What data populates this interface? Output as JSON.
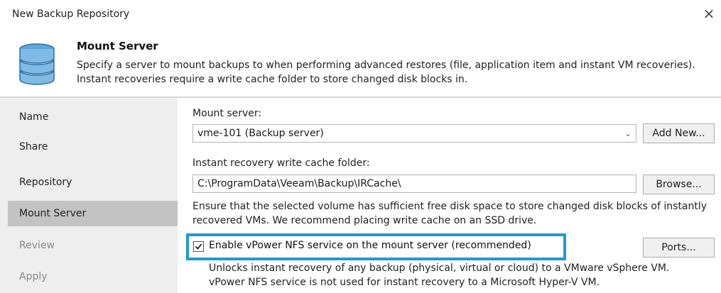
{
  "window": {
    "title": "New Backup Repository",
    "close_icon": "×"
  },
  "header": {
    "icon": "database-icon",
    "title": "Mount Server",
    "description_line1": "Specify a server to mount backups to when performing advanced restores (file, application item and instant VM recoveries).",
    "description_line2": "Instant recoveries require a write cache folder to store changed disk blocks in."
  },
  "sidebar": {
    "items": [
      {
        "label": "Name",
        "state": "normal"
      },
      {
        "label": "Share",
        "state": "normal"
      },
      {
        "label": "Repository",
        "state": "normal"
      },
      {
        "label": "Mount Server",
        "state": "active"
      },
      {
        "label": "Review",
        "state": "disabled"
      },
      {
        "label": "Apply",
        "state": "disabled"
      }
    ]
  },
  "mount_server": {
    "label": "Mount server:",
    "selected": "vme-101 (Backup server)",
    "add_new_label": "Add New..."
  },
  "cache_folder": {
    "label": "Instant recovery write cache folder:",
    "value": "C:\\ProgramData\\Veeam\\Backup\\IRCache\\",
    "browse_label": "Browse...",
    "note_line1": "Ensure that the selected volume has sufficient free disk space to store changed disk blocks of instantly",
    "note_line2": "recovered VMs. We recommend placing write cache on an SSD drive."
  },
  "nfs": {
    "checkbox_label": "Enable vPower NFS service on the mount server (recommended)",
    "checked": true,
    "ports_label": "Ports...",
    "note_line1": "Unlocks instant recovery of any backup (physical, virtual or cloud) to a VMware vSphere VM.",
    "note_line2": "vPower NFS service is not used for instant recovery to a Microsoft Hyper-V VM."
  },
  "colors": {
    "highlight": "#1e9ad6",
    "active_nav": "#c3c3c3",
    "sidebar_bg": "#eeeeee"
  }
}
